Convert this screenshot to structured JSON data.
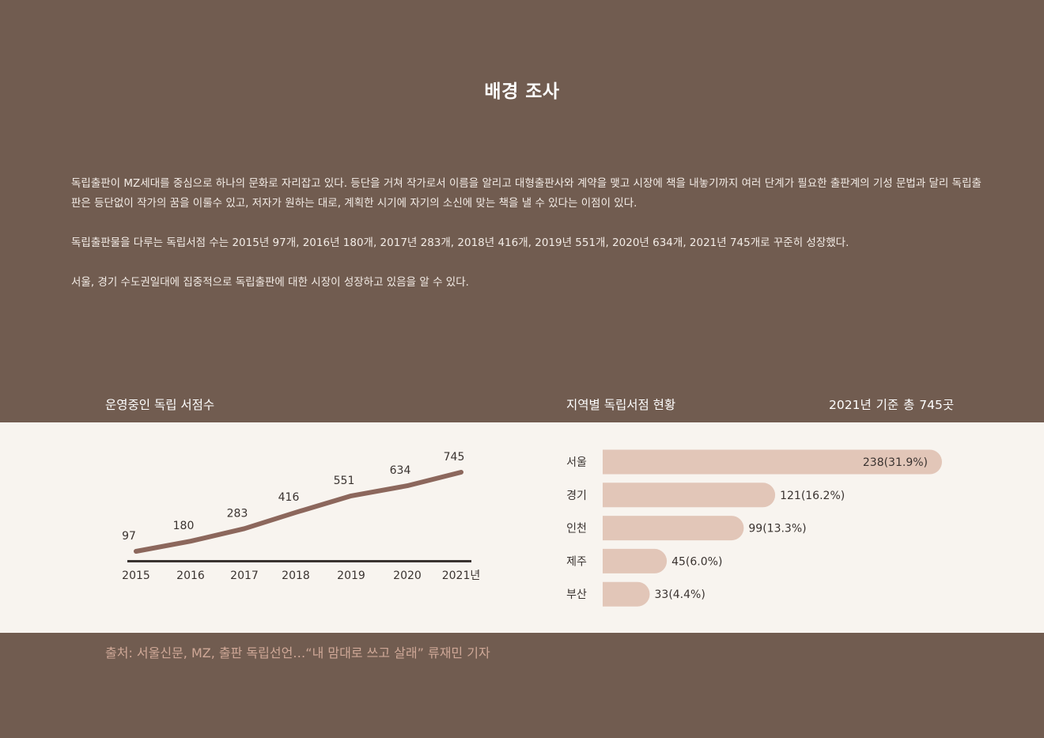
{
  "page": {
    "title": "배경 조사",
    "paragraphs": [
      "독립출판이 MZ세대를 중심으로 하나의 문화로 자리잡고 있다. 등단을 거쳐 작가로서 이름을 알리고 대형출판사와 계약을 맺고 시장에 책을 내놓기까지 여러 단계가 필요한 출판계의 기성 문법과 달리 독립출판은 등단없이 작가의 꿈을 이룰수 있고, 저자가 원하는 대로, 계획한 시기에 자기의 소신에 맞는 책을 낼 수 있다는 이점이 있다.",
      "독립출판물을 다루는 독립서점 수는 2015년 97개, 2016년 180개, 2017년 283개, 2018년 416개, 2019년 551개, 2020년 634개, 2021년 745개로 꾸준히 성장했다.",
      "서울, 경기 수도권일대에  집중적으로 독립출판에 대한 시장이 성장하고 있음을  알 수 있다."
    ],
    "source": "출처: 서울신문,  MZ, 출판 독립선언…“내 맘대로 쓰고 살래” 류재민 기자"
  },
  "colors": {
    "background": "#715c50",
    "band": "#f8f4ef",
    "line": "#8c675c",
    "axis": "#3a3330",
    "bar": "#e2c6b8",
    "source_text": "#cfa897"
  },
  "chart_data": [
    {
      "type": "line",
      "title": "운영중인 독립 서점수",
      "x": [
        "2015",
        "2016",
        "2017",
        "2018",
        "2019",
        "2020",
        "2021년"
      ],
      "series": [
        {
          "values": [
            97,
            180,
            283,
            416,
            551,
            634,
            745
          ]
        }
      ],
      "data_labels": [
        "97",
        "180",
        "283",
        "416",
        "551",
        "634",
        "745"
      ],
      "grid": false
    },
    {
      "type": "bar",
      "orientation": "horizontal",
      "title": "지역별 독립서점 현황",
      "subtitle": "2021년  기준  총 745곳",
      "categories": [
        "서울",
        "경기",
        "인천",
        "제주",
        "부산"
      ],
      "values": [
        238,
        121,
        99,
        45,
        33
      ],
      "data_labels": [
        "238(31.9%)",
        "121(16.2%)",
        "99(13.3%)",
        "45(6.0%)",
        "33(4.4%)"
      ],
      "grid": false
    }
  ]
}
